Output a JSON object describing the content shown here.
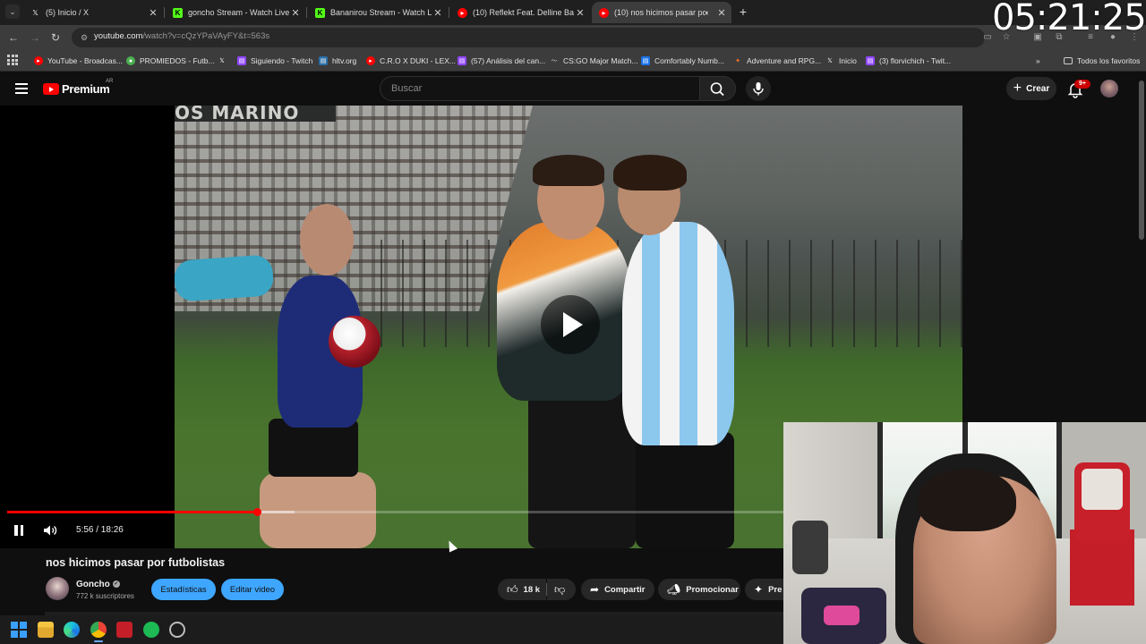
{
  "browser": {
    "tabs": [
      {
        "title": "(5) Inicio / X",
        "favicon": "x-logo-icon",
        "active": false
      },
      {
        "title": "goncho Stream - Watch Live on",
        "favicon": "kick-logo-icon",
        "active": false
      },
      {
        "title": "Bananirou Stream - Watch Live",
        "favicon": "kick-logo-icon",
        "active": false
      },
      {
        "title": "(10) Reflekt Feat. Delline Bass -",
        "favicon": "youtube-logo-icon",
        "active": false
      },
      {
        "title": "(10) nos hicimos pasar por",
        "favicon": "youtube-logo-icon",
        "active": true,
        "audio": true
      }
    ],
    "url_host": "youtube.com",
    "url_path": "/watch?v=cQzYPaVAyFY&t=563s",
    "bookmarks": [
      {
        "label": "YouTube - Broadcas...",
        "icon": "youtube-icon"
      },
      {
        "label": "PROMIEDOS - Futb...",
        "icon": "promiedos-icon"
      },
      {
        "label": "",
        "icon": "x-logo-icon"
      },
      {
        "label": "Siguiendo - Twitch",
        "icon": "twitch-icon"
      },
      {
        "label": "hltv.org",
        "icon": "hltv-icon"
      },
      {
        "label": "C.R.O X DUKI - LEX...",
        "icon": "youtube-icon"
      },
      {
        "label": "(57) Análisis del can...",
        "icon": "twitch-icon"
      },
      {
        "label": "CS:GO Major Match...",
        "icon": "cs-icon"
      },
      {
        "label": "Comfortably Numb...",
        "icon": "bookmark-doc-icon"
      },
      {
        "label": "Adventure and RPG...",
        "icon": "game-icon"
      },
      {
        "label": "Inicio",
        "icon": "x-logo-icon"
      },
      {
        "label": "(3) florvichich - Twit...",
        "icon": "twitch-icon"
      }
    ],
    "bookmarks_folder": "Todos los favoritos"
  },
  "overlay_clock": "05:21:25",
  "youtube": {
    "logo_text": "Premium",
    "country": "AR",
    "search_placeholder": "Buscar",
    "create_label": "Crear",
    "notifications_badge": "9+"
  },
  "player": {
    "stadium_text": "OS MARINO",
    "timecode": "5:56 / 18:26",
    "progress_fraction": 0.3218,
    "buffer_fraction": 0.37
  },
  "video": {
    "title": "nos hicimos pasar por futbolistas",
    "channel": "Goncho",
    "subscribers": "772 k suscriptores",
    "stats_label": "Estadísticas",
    "edit_label": "Editar video",
    "likes": "18 k",
    "share_label": "Compartir",
    "promote_label": "Promocionar",
    "more_label": "Pre"
  },
  "colors": {
    "accent_red": "#ff0000",
    "blue_button": "#3ea6ff"
  }
}
